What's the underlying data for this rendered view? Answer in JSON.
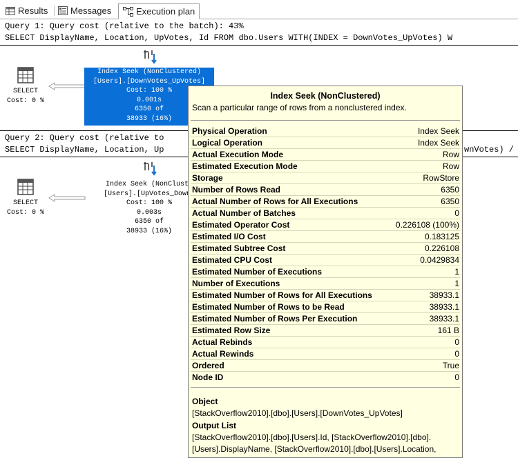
{
  "tabs": [
    {
      "label": "Results",
      "icon": "grid-icon"
    },
    {
      "label": "Messages",
      "icon": "messages-icon"
    },
    {
      "label": "Execution plan",
      "icon": "execution-plan-icon"
    }
  ],
  "query1": {
    "header": "Query 1: Query cost (relative to the batch): 43%",
    "sql": "SELECT DisplayName, Location, UpVotes, Id FROM dbo.Users WITH(INDEX = DownVotes_UpVotes) W",
    "select_node": {
      "label": "SELECT",
      "cost": "Cost: 0 %"
    },
    "seek_node": {
      "line1": "Index Seek (NonClustered)",
      "line2": "[Users].[DownVotes_UpVotes]",
      "line3": "Cost: 100 %",
      "line4": "0.001s",
      "line5": "6350 of",
      "line6": "38933 (16%)"
    }
  },
  "query2": {
    "header": "Query 2: Query cost (relative to",
    "sql_left": "SELECT DisplayName, Location, Up",
    "sql_right": "wnVotes) /",
    "select_node": {
      "label": "SELECT",
      "cost": "Cost: 0 %"
    },
    "seek_node": {
      "line1": "Index Seek (NonClusté",
      "line2": "[Users].[UpVotes_Down’",
      "line3": "Cost: 100 %",
      "line4": "0.003s",
      "line5": "6350 of",
      "line6": "38933 (16%)"
    }
  },
  "tooltip": {
    "title": "Index Seek (NonClustered)",
    "description": "Scan a particular range of rows from a nonclustered index.",
    "properties": [
      {
        "name": "Physical Operation",
        "value": "Index Seek"
      },
      {
        "name": "Logical Operation",
        "value": "Index Seek"
      },
      {
        "name": "Actual Execution Mode",
        "value": "Row"
      },
      {
        "name": "Estimated Execution Mode",
        "value": "Row"
      },
      {
        "name": "Storage",
        "value": "RowStore"
      },
      {
        "name": "Number of Rows Read",
        "value": "6350"
      },
      {
        "name": "Actual Number of Rows for All Executions",
        "value": "6350"
      },
      {
        "name": "Actual Number of Batches",
        "value": "0"
      },
      {
        "name": "Estimated Operator Cost",
        "value": "0.226108 (100%)"
      },
      {
        "name": "Estimated I/O Cost",
        "value": "0.183125"
      },
      {
        "name": "Estimated Subtree Cost",
        "value": "0.226108"
      },
      {
        "name": "Estimated CPU Cost",
        "value": "0.0429834"
      },
      {
        "name": "Estimated Number of Executions",
        "value": "1"
      },
      {
        "name": "Number of Executions",
        "value": "1"
      },
      {
        "name": "Estimated Number of Rows for All Executions",
        "value": "38933.1"
      },
      {
        "name": "Estimated Number of Rows to be Read",
        "value": "38933.1"
      },
      {
        "name": "Estimated Number of Rows Per Execution",
        "value": "38933.1"
      },
      {
        "name": "Estimated Row Size",
        "value": "161 B"
      },
      {
        "name": "Actual Rebinds",
        "value": "0"
      },
      {
        "name": "Actual Rewinds",
        "value": "0"
      },
      {
        "name": "Ordered",
        "value": "True"
      },
      {
        "name": "Node ID",
        "value": "0"
      }
    ],
    "object_heading": "Object",
    "object_value": "[StackOverflow2010].[dbo].[Users].[DownVotes_UpVotes]",
    "output_heading": "Output List",
    "output_line1": "[StackOverflow2010].[dbo].[Users].Id, [StackOverflow2010].[dbo].",
    "output_line2": "[Users].DisplayName, [StackOverflow2010].[dbo].[Users].Location,"
  }
}
